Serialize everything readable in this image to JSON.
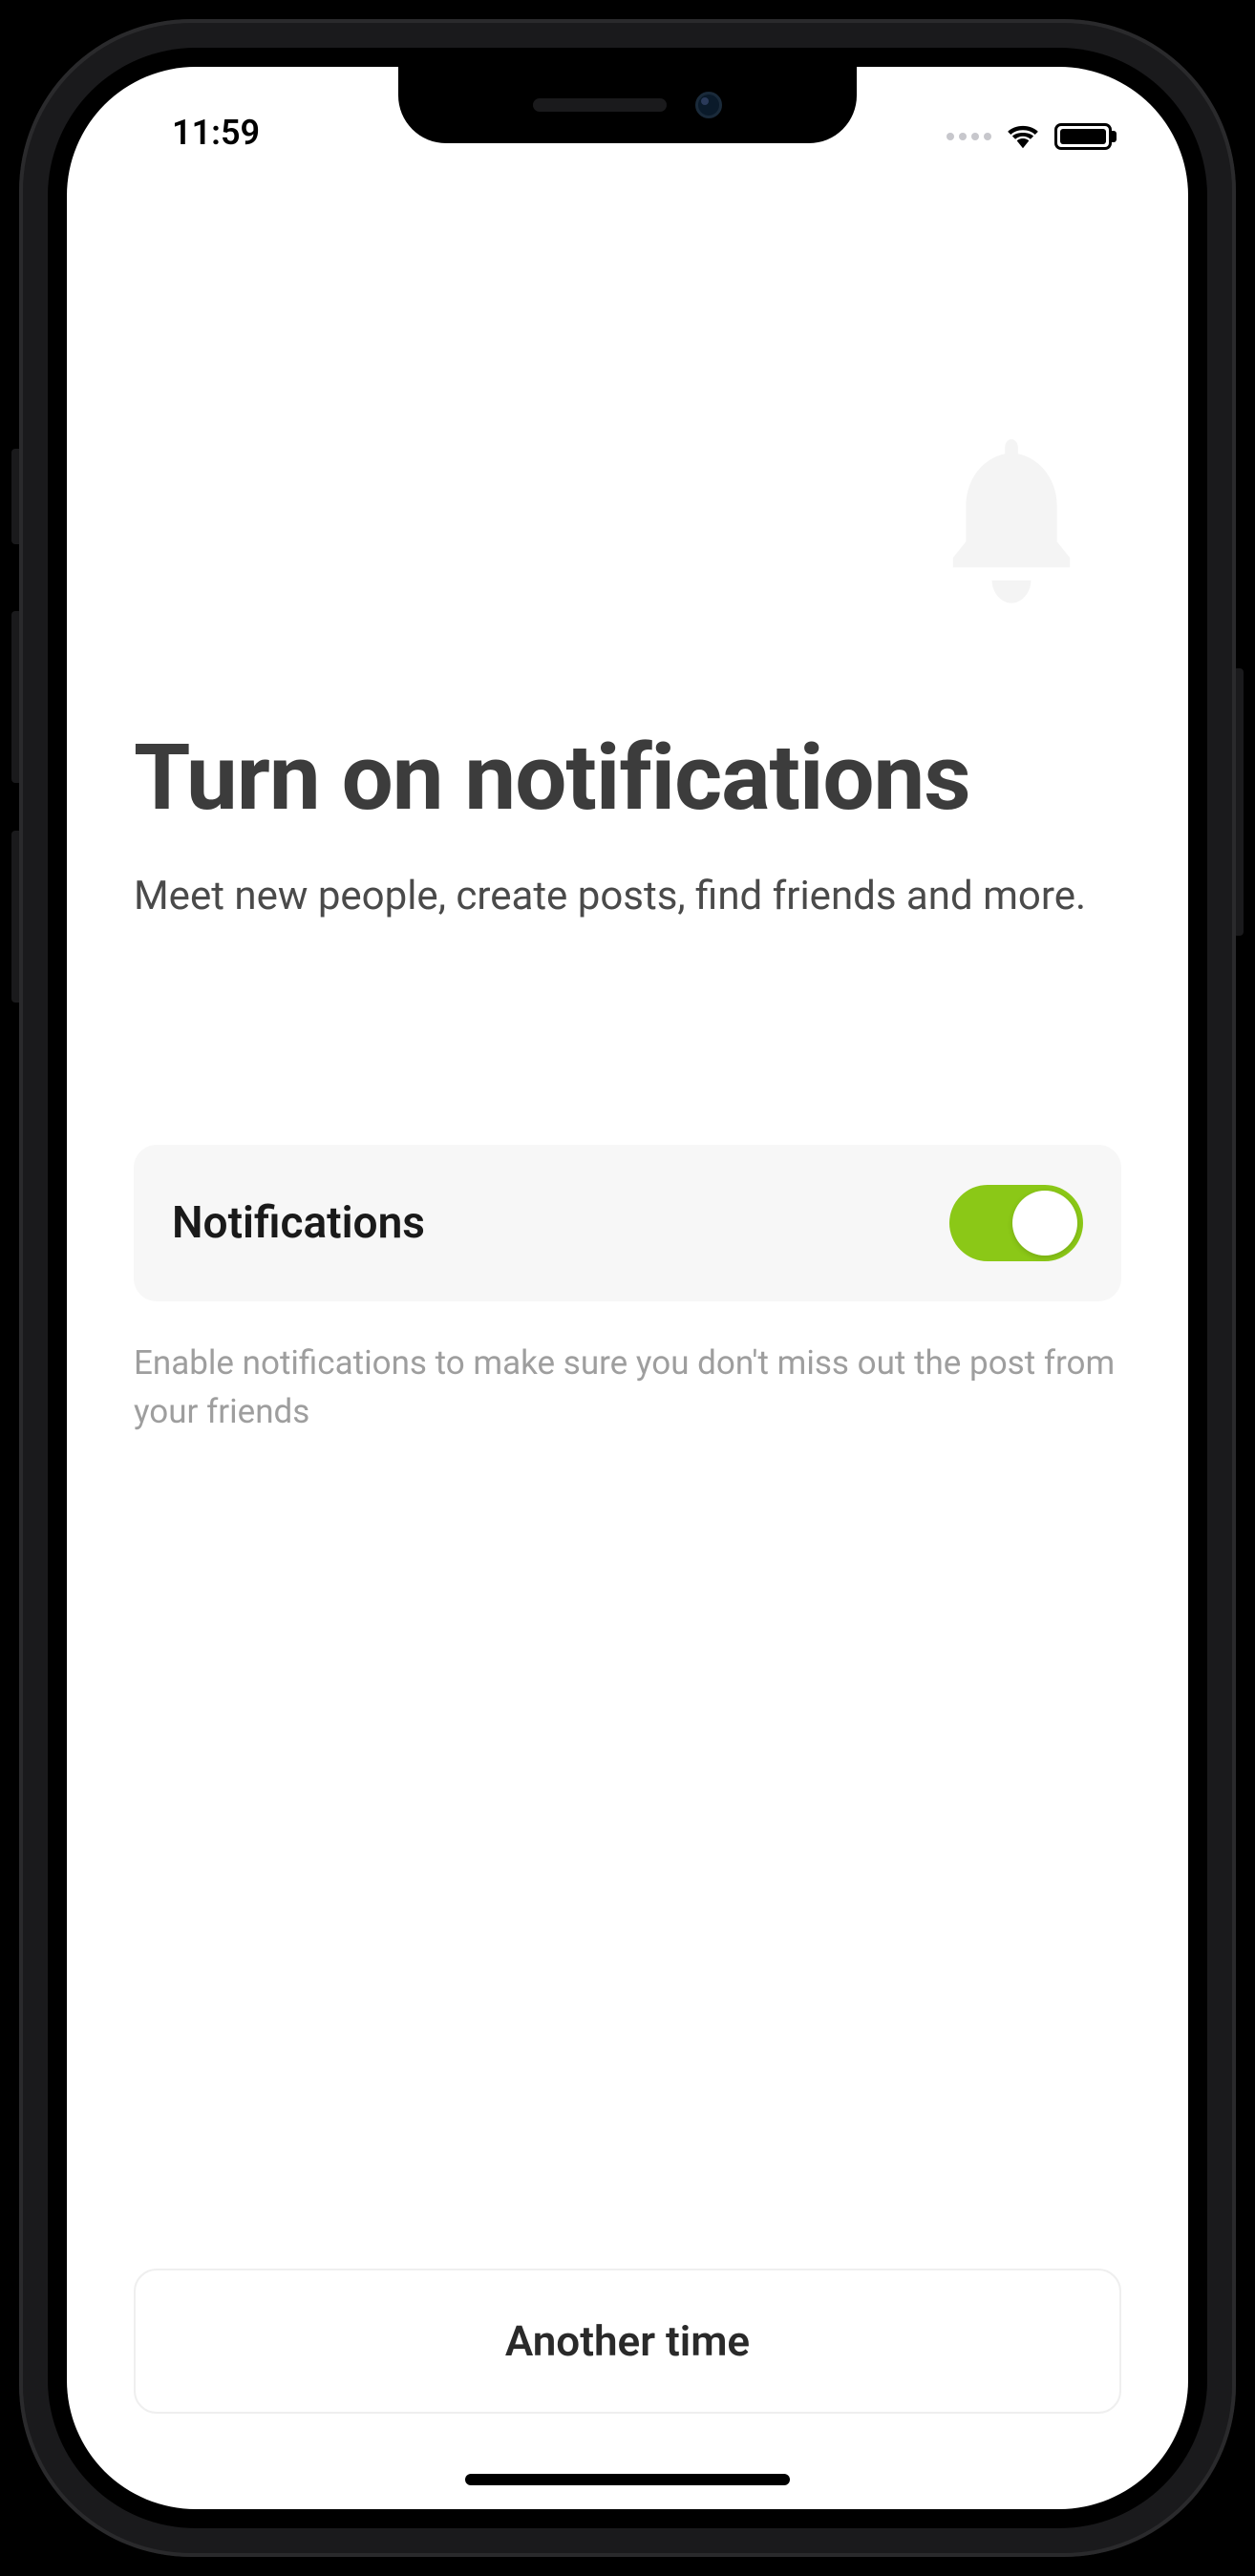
{
  "status": {
    "time": "11:59"
  },
  "hero": {
    "title": "Turn on notifications",
    "subtitle": "Meet new people, create posts, find friends and more."
  },
  "toggle": {
    "label": "Notifications",
    "enabled": true,
    "helper": "Enable notifications to make sure you don't miss out the post from your friends"
  },
  "actions": {
    "secondary": "Another time"
  },
  "icons": {
    "bell": "bell-icon"
  },
  "colors": {
    "accent": "#8bc817"
  }
}
